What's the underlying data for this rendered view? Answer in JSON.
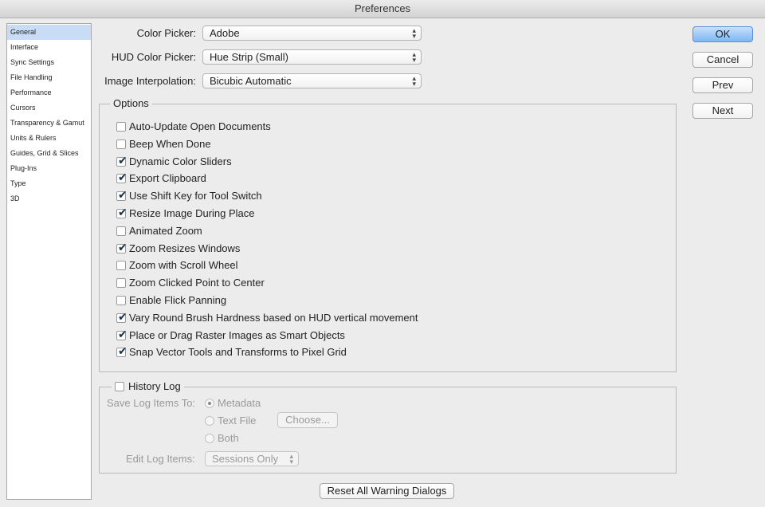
{
  "window": {
    "title": "Preferences"
  },
  "sidebar": {
    "items": [
      {
        "label": "General",
        "active": true
      },
      {
        "label": "Interface"
      },
      {
        "label": "Sync Settings"
      },
      {
        "label": "File Handling"
      },
      {
        "label": "Performance"
      },
      {
        "label": "Cursors"
      },
      {
        "label": "Transparency & Gamut"
      },
      {
        "label": "Units & Rulers"
      },
      {
        "label": "Guides, Grid & Slices"
      },
      {
        "label": "Plug-Ins"
      },
      {
        "label": "Type"
      },
      {
        "label": "3D"
      }
    ]
  },
  "fields": {
    "color_picker": {
      "label": "Color Picker:",
      "value": "Adobe"
    },
    "hud_color_picker": {
      "label": "HUD Color Picker:",
      "value": "Hue Strip (Small)"
    },
    "image_interpolation": {
      "label": "Image Interpolation:",
      "value": "Bicubic Automatic"
    }
  },
  "options": {
    "title": "Options",
    "items": [
      {
        "label": "Auto-Update Open Documents",
        "checked": false
      },
      {
        "label": "Beep When Done",
        "checked": false
      },
      {
        "label": "Dynamic Color Sliders",
        "checked": true
      },
      {
        "label": "Export Clipboard",
        "checked": true
      },
      {
        "label": "Use Shift Key for Tool Switch",
        "checked": true
      },
      {
        "label": "Resize Image During Place",
        "checked": true
      },
      {
        "label": "Animated Zoom",
        "checked": false
      },
      {
        "label": "Zoom Resizes Windows",
        "checked": true
      },
      {
        "label": "Zoom with Scroll Wheel",
        "checked": false
      },
      {
        "label": "Zoom Clicked Point to Center",
        "checked": false
      },
      {
        "label": "Enable Flick Panning",
        "checked": false
      },
      {
        "label": "Vary Round Brush Hardness based on HUD vertical movement",
        "checked": true
      },
      {
        "label": "Place or Drag Raster Images as Smart Objects",
        "checked": true
      },
      {
        "label": "Snap Vector Tools and Transforms to Pixel Grid",
        "checked": true
      }
    ]
  },
  "history_log": {
    "title": "History Log",
    "checked": false,
    "save_label": "Save Log Items To:",
    "radio_metadata": "Metadata",
    "radio_text_file": "Text File",
    "radio_both": "Both",
    "choose_button": "Choose...",
    "edit_label": "Edit Log Items:",
    "edit_value": "Sessions Only"
  },
  "buttons": {
    "ok": "OK",
    "cancel": "Cancel",
    "prev": "Prev",
    "next": "Next",
    "reset_warnings": "Reset All Warning Dialogs"
  },
  "icons": {
    "select_arrows": "↕",
    "checkmark": "✔"
  }
}
